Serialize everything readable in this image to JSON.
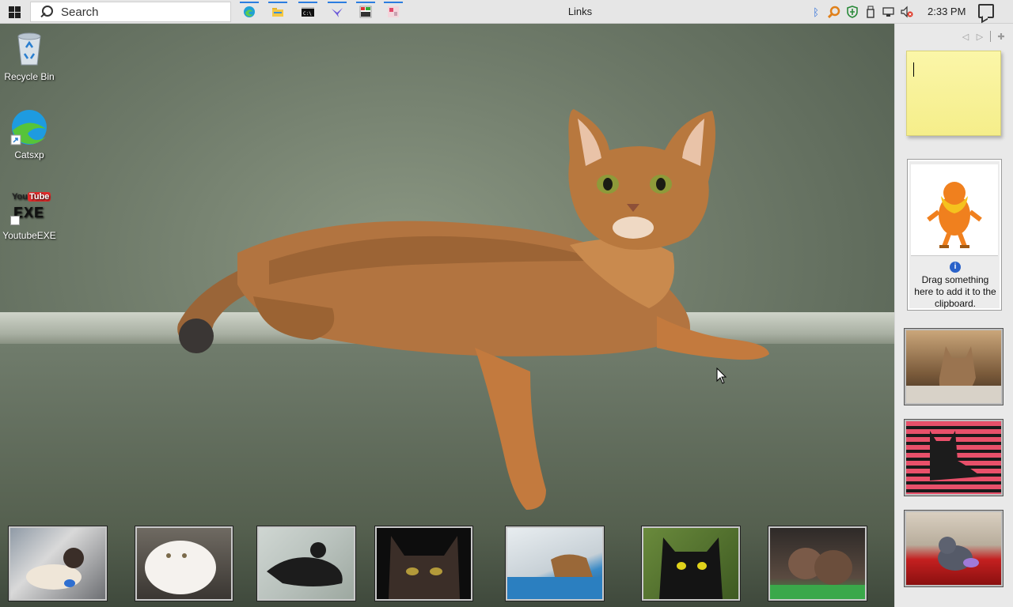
{
  "taskbar": {
    "search_placeholder": "Search",
    "title": "Links",
    "clock": "2:33 PM",
    "pinned": [
      {
        "name": "edge-icon"
      },
      {
        "name": "file-explorer-icon"
      },
      {
        "name": "command-prompt-icon"
      },
      {
        "name": "bird-app-icon"
      },
      {
        "name": "winexe-icon"
      },
      {
        "name": "paint-app-icon"
      }
    ]
  },
  "desktop": {
    "icons": [
      {
        "label": "Recycle Bin",
        "icon": "recycle-bin-icon"
      },
      {
        "label": "Catsxp",
        "icon": "catsxp-browser-icon"
      },
      {
        "label": "YoutubeEXE",
        "icon": "youtube-exe-icon",
        "logo_text_top": "YouTube",
        "logo_text_bottom": "EXE"
      }
    ],
    "wallpaper": "abyssinian-cat-on-sofa",
    "thumbnails": [
      {
        "subject": "siamese-cat-with-toy"
      },
      {
        "subject": "white-persian-cat"
      },
      {
        "subject": "black-cat-lying"
      },
      {
        "subject": "dark-cat-closeup"
      },
      {
        "subject": "cat-at-window"
      },
      {
        "subject": "black-cat-yellow-eyes"
      },
      {
        "subject": "cats-on-grass"
      }
    ]
  },
  "sidebar": {
    "nav_prev": "◁",
    "nav_next": "▷",
    "add": "✚",
    "note_text": "",
    "clipboard_hint": "Drag something here to add it to the clipboard.",
    "clipboard_image": "lorax-character",
    "photos": [
      {
        "subject": "tabby-cat-sitting"
      },
      {
        "subject": "black-cat-pink-stripes"
      },
      {
        "subject": "grey-cat-red-blanket"
      }
    ]
  },
  "colors": {
    "taskbar_bg": "#e6e6e6",
    "sidebar_bg": "#e9e9e9",
    "note_yellow": "#fbf6a8",
    "accent": "#2b7de0"
  }
}
